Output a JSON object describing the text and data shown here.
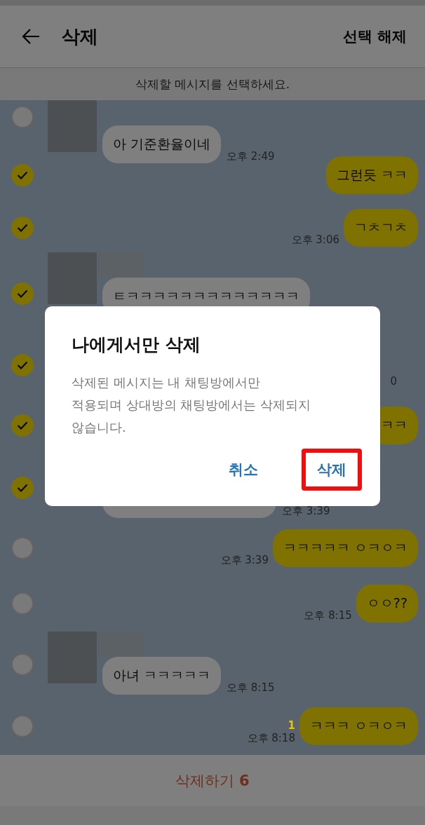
{
  "header": {
    "title": "삭제",
    "action": "선택 해제"
  },
  "notice": "삭제할 메시지를 선택하세요.",
  "messages": [
    {
      "kind": "received",
      "checked": false,
      "avatar": true,
      "text": "아 기준환율이네",
      "time": "오후 2:49"
    },
    {
      "kind": "sent",
      "checked": true,
      "text": "그런듯 ㅋㅋ"
    },
    {
      "kind": "sent",
      "checked": true,
      "text": "ㄱㅊㄱㅊ",
      "time": "오후 3:06"
    },
    {
      "kind": "received",
      "checked": true,
      "avatar": true,
      "name_hidden": true,
      "text": "ㅌㅋㅋㅋㅋㅋㅋㅋㅋㅋㅋㅋㅋㅋ"
    },
    {
      "kind": "time_only",
      "checked": true,
      "time": "0"
    },
    {
      "kind": "sent",
      "checked": true,
      "text": "ㅋㅋ"
    },
    {
      "kind": "received",
      "checked": true,
      "time": "오후 3:39"
    },
    {
      "kind": "sent",
      "checked": false,
      "text": "ㅋㅋㅋㅋㅋ ㅇㅋㅇㅋ",
      "time": "오후 3:39"
    },
    {
      "kind": "sent",
      "checked": false,
      "text": "ㅇㅇ??",
      "time": "오후 8:15"
    },
    {
      "kind": "received",
      "checked": false,
      "avatar": true,
      "name_hidden": true,
      "text": "아녀 ㅋㅋㅋㅋㅋ",
      "time": "오후 8:15"
    },
    {
      "kind": "sent",
      "checked": false,
      "text": "ㅋㅋㅋ ㅇㅋㅇㅋ",
      "unread": "1",
      "time": "오후 8:18"
    }
  ],
  "delete_bar": {
    "label": "삭제하기 **6**"
  },
  "dialog": {
    "title": "나에게서만 삭제",
    "body": "삭제된 메시지는 내 채팅방에서만\n적용되며 상대방의 채팅방에서는 삭제되지 않습니다.",
    "buttons": [
      {
        "label": "취소",
        "highlighted": false
      },
      {
        "label": "삭제",
        "highlighted": true
      }
    ]
  }
}
